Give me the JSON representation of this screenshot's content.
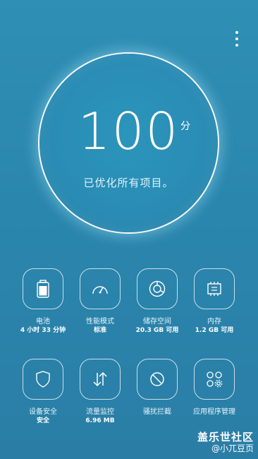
{
  "header": {
    "menu_icon": "more-vertical-icon"
  },
  "score": {
    "value": "100",
    "unit": "分",
    "status": "已优化所有项目。"
  },
  "tiles": [
    {
      "label": "电池",
      "value": "4 小时 33 分钟",
      "icon": "battery-icon"
    },
    {
      "label": "性能模式",
      "value": "标准",
      "icon": "speedometer-icon"
    },
    {
      "label": "储存空间",
      "value": "20.3 GB 可用",
      "icon": "storage-icon"
    },
    {
      "label": "内存",
      "value": "1.2 GB 可用",
      "icon": "memory-chip-icon"
    },
    {
      "label": "设备安全",
      "value": "安全",
      "icon": "shield-icon"
    },
    {
      "label": "流量监控",
      "value": "6.96 MB",
      "icon": "data-arrows-icon"
    },
    {
      "label": "骚扰拦截",
      "value": "",
      "icon": "block-icon"
    },
    {
      "label": "应用程序管理",
      "value": "",
      "icon": "apps-settings-icon"
    }
  ],
  "watermark": {
    "title": "盖乐世社区",
    "user": "@小兀豆页"
  },
  "colors": {
    "background": "#2a86ad",
    "accent": "#ffffff"
  }
}
